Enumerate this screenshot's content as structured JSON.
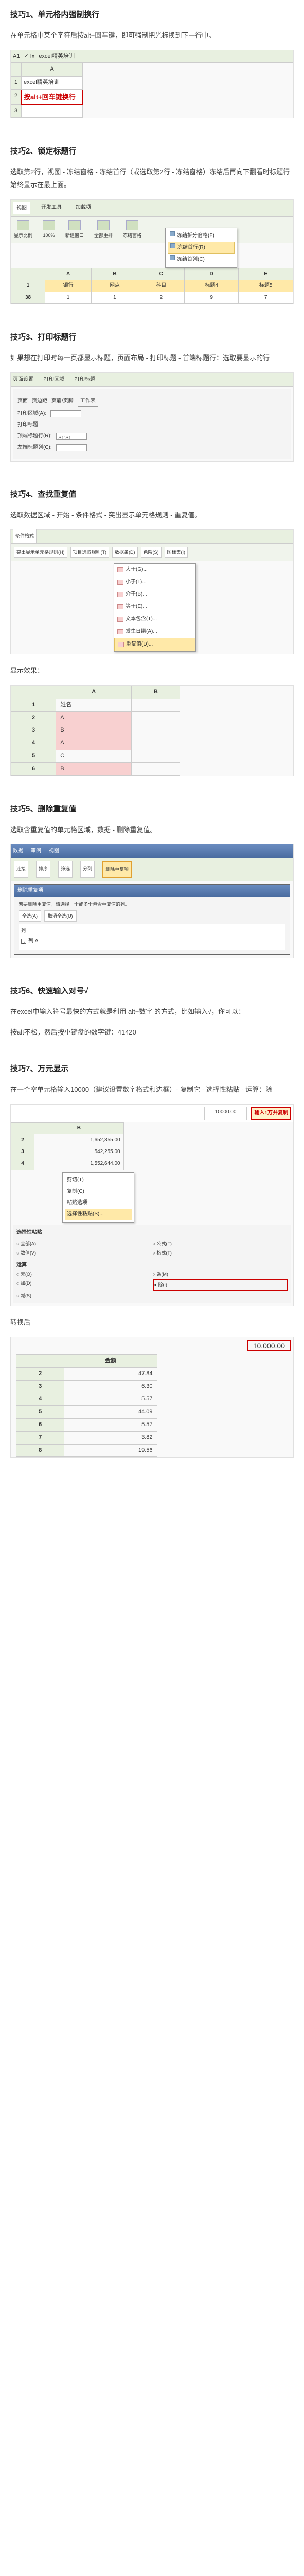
{
  "tip1": {
    "heading": "技巧1、单元格内强制换行",
    "body": "在单元格中某个字符后按alt+回车键，即可强制把光标换到下一行中。",
    "cell_ref": "A1",
    "fx_content": "excel精英培训",
    "callout": "按alt+回车键换行"
  },
  "tip2": {
    "heading": "技巧2、锁定标题行",
    "body": "选取第2行，视图 - 冻结窗格 - 冻结首行（或选取第2行 - 冻结窗格）冻结后再向下翻看时标题行始终显示在最上面。",
    "tabs": [
      "视图",
      "开发工具",
      "加载项"
    ],
    "groups": [
      "显示比例",
      "100%",
      "新建窗口",
      "全部重排",
      "冻结窗格"
    ],
    "menu_items": [
      "冻结拆分窗格(F)",
      "冻结首行(R)",
      "冻结首列(C)"
    ],
    "table_headers": [
      "",
      "A",
      "B",
      "C",
      "D",
      "E"
    ],
    "table_r1": [
      "1",
      "银行",
      "网点",
      "科目",
      "标题4",
      "标题5"
    ],
    "table_r2": [
      "38",
      "1",
      "1",
      "2",
      "9",
      "7"
    ]
  },
  "tip3": {
    "heading": "技巧3、打印标题行",
    "body": "如果想在打印时每一页都显示标题，页面布局 - 打印标题 - 首端标题行：选取要显示的行",
    "ribbon": [
      "页面设置",
      "打印区域",
      "打印标题"
    ],
    "dlg_title": "页面设置",
    "dlg_tabs": [
      "页面",
      "页边距",
      "页眉/页脚",
      "工作表"
    ],
    "field1": "打印区域(A):",
    "field2": "打印标题",
    "field3": "顶端标题行(R):",
    "field3_val": "$1:$1",
    "field4": "左端标题列(C):"
  },
  "tip4": {
    "heading": "技巧4、查找重复值",
    "body": "选取数据区域 - 开始 - 条件格式 - 突出显示单元格规则 - 重复值。",
    "btn_main": "条件格式",
    "menu1": "突出显示单元格规则(H)",
    "submenu": [
      "大于(G)...",
      "小于(L)...",
      "介于(B)...",
      "等于(E)...",
      "文本包含(T)...",
      "发生日期(A)...",
      "重复值(D)..."
    ],
    "other_menus": [
      "项目选取规则(T)",
      "数据条(D)",
      "色阶(S)",
      "图标集(I)"
    ],
    "result_label": "显示效果：",
    "res_headers": [
      "",
      "A",
      "B"
    ],
    "res_rows": [
      [
        "1",
        "姓名",
        ""
      ],
      [
        "2",
        "A",
        ""
      ],
      [
        "3",
        "B",
        ""
      ],
      [
        "4",
        "A",
        ""
      ],
      [
        "5",
        "C",
        ""
      ],
      [
        "6",
        "B",
        ""
      ]
    ],
    "dup_rows": [
      2,
      3,
      4,
      6
    ]
  },
  "tip5": {
    "heading": "技巧5、删除重复值",
    "body": "选取含重复值的单元格区域，数据 - 删除重复值。",
    "ribbon_tabs": [
      "数据",
      "审阅",
      "视图"
    ],
    "buttons": [
      "连接",
      "排序",
      "筛选",
      "分列",
      "删除重复项"
    ],
    "dlg_title": "删除重复项",
    "dlg_text": "若要删除重复值，请选择一个或多个包含重复值的列。",
    "dlg_btns": [
      "全选(A)",
      "取消全选(U)"
    ],
    "col_label": "列",
    "col_item": "列 A"
  },
  "tip6": {
    "heading": "技巧6、快速输入对号√",
    "body1": "在excel中输入符号最快的方式就是利用 alt+数字 的方式，比如输入√，你可以：",
    "body2": "按alt不松，然后按小键盘的数字键：41420"
  },
  "tip7": {
    "heading": "技巧7、万元显示",
    "body": "在一个空单元格输入10000（建议设置数字格式和边框）- 复制它 - 选择性粘贴 - 运算：除",
    "callout": "输入1万并复制",
    "cell_val": "10000.00",
    "ctx_items": [
      "剪切(T)",
      "复制(C)",
      "粘贴选项:",
      "选择性粘贴(S)..."
    ],
    "dlg_title": "选择性粘贴",
    "paste_opts": [
      "全部(A)",
      "公式(F)",
      "数值(V)",
      "格式(T)"
    ],
    "op_label": "运算",
    "op_opts": [
      "无(O)",
      "加(D)",
      "减(S)",
      "乘(M)",
      "除(I)"
    ],
    "sample_vals": [
      "1,652,355.00",
      "542,255.00",
      "1,552,644.00"
    ],
    "after_label": "转换后",
    "after_header": "金额",
    "after_vals": [
      "47.84",
      "6.30",
      "5.57",
      "44.09",
      "5.57",
      "3.82",
      "19.56"
    ],
    "after_ref": "10,000.00"
  }
}
